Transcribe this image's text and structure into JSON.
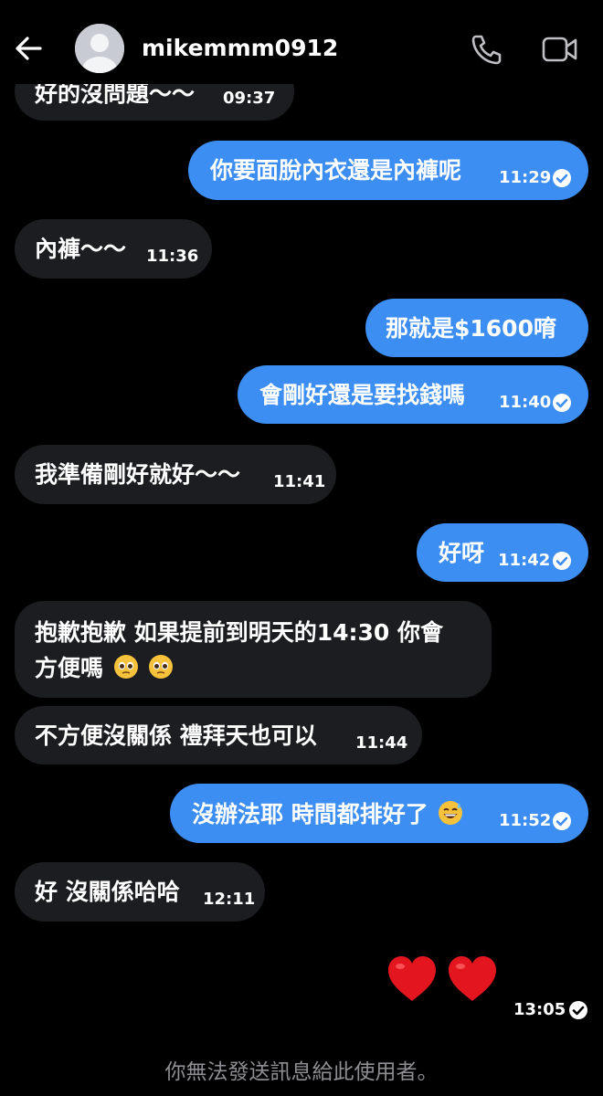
{
  "header": {
    "username": "mikemmm0912"
  },
  "messages": [
    {
      "side": "in",
      "text": "好的沒問題～～",
      "time": "09:37"
    },
    {
      "side": "out",
      "text": "你要面脫內衣還是內褲呢",
      "time": "11:29",
      "read": true
    },
    {
      "side": "in",
      "text": "內褲～～",
      "time": "11:36"
    },
    {
      "side": "out",
      "text": "那就是$1600唷",
      "time": ""
    },
    {
      "side": "out",
      "text": "會剛好還是要找錢嗎",
      "time": "11:40",
      "read": true
    },
    {
      "side": "in",
      "text": "我準備剛好就好～～",
      "time": "11:41"
    },
    {
      "side": "out",
      "text": "好呀",
      "time": "11:42",
      "read": true
    },
    {
      "side": "in",
      "text_line1": "抱歉抱歉 如果提前到明天的14:30 你會",
      "text_line2": "方便嗎",
      "emoji": "pleading-face x2"
    },
    {
      "side": "in",
      "text": "不方便沒關係 禮拜天也可以",
      "time": "11:44"
    },
    {
      "side": "out",
      "text": "沒辦法耶 時間都排好了",
      "emoji": "grinning-sweat-face",
      "time": "11:52",
      "read": true
    },
    {
      "side": "in",
      "text": "好 沒關係哈哈",
      "time": "12:11"
    },
    {
      "side": "out",
      "hearts": 2,
      "time": "13:05",
      "read": true
    }
  ],
  "footer": {
    "notice": "你無法發送訊息給此使用者。"
  },
  "colors": {
    "background": "#000000",
    "incoming_bubble": "#1c1d20",
    "outgoing_bubble": "#3d8ef2",
    "footer_text": "#8e8e93"
  }
}
